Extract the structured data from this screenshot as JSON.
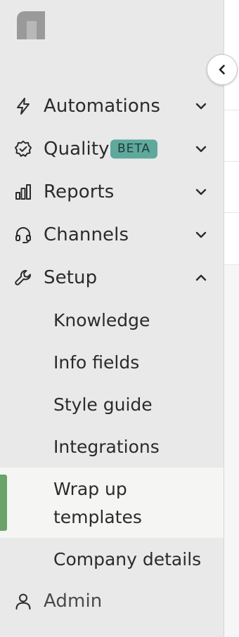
{
  "sidebar": {
    "collapse_button": {
      "icon": "chevron-left-icon"
    },
    "logo": {
      "icon": "brand-logo"
    },
    "nav": [
      {
        "label": "Automations",
        "icon": "lightning-icon",
        "chevron": "chevron-down-icon"
      },
      {
        "label": "Quality",
        "icon": "badge-check-icon",
        "badge": "BETA",
        "chevron": "chevron-down-icon"
      },
      {
        "label": "Reports",
        "icon": "bar-chart-icon",
        "chevron": "chevron-down-icon"
      },
      {
        "label": "Channels",
        "icon": "headset-icon",
        "chevron": "chevron-down-icon"
      },
      {
        "label": "Setup",
        "icon": "wrench-icon",
        "chevron": "chevron-up-icon"
      }
    ],
    "setup_items": [
      {
        "label": "Knowledge"
      },
      {
        "label": "Info fields"
      },
      {
        "label": "Style guide"
      },
      {
        "label": "Integrations"
      },
      {
        "label_line1": "Wrap up",
        "label_line2": "templates",
        "active": true
      },
      {
        "label": "Company details"
      }
    ],
    "admin": {
      "label": "Admin",
      "icon": "user-icon"
    }
  },
  "colors": {
    "sidebar_bg": "#e9e9e9",
    "active_item_bg": "#f5f5f3",
    "active_indicator": "#6aa36a",
    "beta_badge_bg": "#5fa89c",
    "text": "#2b2b2b"
  }
}
